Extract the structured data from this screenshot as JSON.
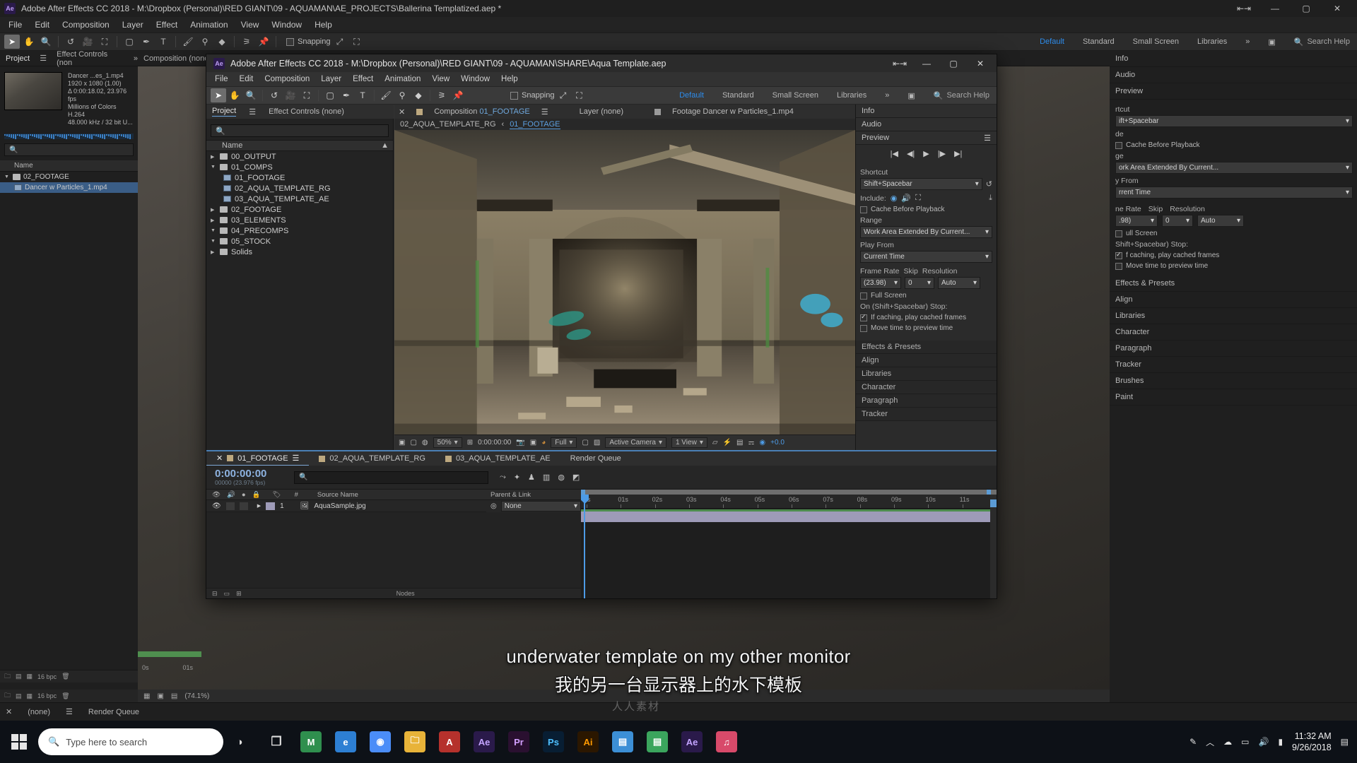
{
  "outer_window": {
    "title": "Adobe After Effects CC 2018 - M:\\Dropbox (Personal)\\RED GIANT\\09 - AQUAMAN\\AE_PROJECTS\\Ballerina Templatized.aep *",
    "app_badge": "Ae",
    "menu": [
      "File",
      "Edit",
      "Composition",
      "Layer",
      "Effect",
      "Animation",
      "View",
      "Window",
      "Help"
    ],
    "snapping_label": "Snapping",
    "workspaces": [
      "Default",
      "Standard",
      "Small Screen",
      "Libraries"
    ],
    "active_workspace": "Default",
    "search_help": "Search Help",
    "panel_tabs": {
      "project": "Project",
      "effect_controls": "Effect Controls (non"
    },
    "viewer_tabs": {
      "composition": "Composition (none)",
      "layer": "Layer (none)",
      "footage": "Footage Dancer w Particles_1.mp4"
    },
    "footage_info": {
      "name": "Dancer ...es_1.mp4",
      "resolution": "1920 x 1080 (1.00)",
      "duration": "Δ 0:00:18.02, 23.976 fps",
      "colors": "Millions of Colors",
      "codec": "H.264",
      "audio": "48.000 kHz / 32 bit U..."
    },
    "column_header": "Name",
    "items": [
      {
        "label": "02_FOOTAGE",
        "type": "folder",
        "expanded": true,
        "selected": false
      },
      {
        "label": "Dancer w Particles_1.mp4",
        "type": "footage",
        "expanded": false,
        "selected": true
      }
    ],
    "bottom_bar": {
      "bpc": "16 bpc",
      "zoom": "(74.1%)"
    },
    "right_panels": [
      "Info",
      "Audio",
      "Preview",
      "Effects & Presets",
      "Align",
      "Libraries",
      "Character",
      "Paragraph",
      "Tracker",
      "Brushes",
      "Paint"
    ],
    "right_preview": {
      "shortcut_label": "rtcut",
      "shortcut_value": "ift+Spacebar",
      "include_label": "de",
      "range_value": "ork Area Extended By Current...",
      "play_from_label": "y From",
      "play_from_value": "rrent Time",
      "frame_rate_label": "ne Rate",
      "skip_label": "Skip",
      "resolution_label": "Resolution",
      "frame_rate_value": ".98)",
      "skip_value": "0",
      "resolution_value": "Auto",
      "full_screen": "ull Screen",
      "stop_label": "Shift+Spacebar) Stop:",
      "cached_frames": "f caching, play cached frames",
      "move_time": "Move time to preview time",
      "cache_before": "Cache Before Playback"
    },
    "timeline_tabs": {
      "none": "(none)",
      "render_queue": "Render Queue"
    },
    "ruler_labels": [
      "0s",
      "01s"
    ]
  },
  "inner_window": {
    "title": "Adobe After Effects CC 2018 - M:\\Dropbox (Personal)\\RED GIANT\\09 - AQUAMAN\\SHARE\\Aqua Template.aep",
    "app_badge": "Ae",
    "menu": [
      "File",
      "Edit",
      "Composition",
      "Layer",
      "Effect",
      "Animation",
      "View",
      "Window",
      "Help"
    ],
    "window_controls": {
      "restore_down": "⇤⇥",
      "minimize": "—",
      "maximize": "▢",
      "close": "✕"
    },
    "snapping_label": "Snapping",
    "workspaces": [
      "Default",
      "Standard",
      "Small Screen",
      "Libraries"
    ],
    "active_workspace": "Default",
    "search_help": "Search Help",
    "overflow": "»",
    "panel_tabs": {
      "project": "Project",
      "effect_controls": "Effect Controls (none)"
    },
    "viewer_tabs": {
      "composition_prefix": "Composition",
      "composition_name": "01_FOOTAGE",
      "layer": "Layer (none)",
      "footage": "Footage Dancer w Particles_1.mp4"
    },
    "breadcrumb": {
      "parent": "02_AQUA_TEMPLATE_RG",
      "separator": "‹",
      "current": "01_FOOTAGE"
    },
    "project_panel": {
      "search_placeholder": "",
      "column_header": "Name",
      "items": [
        {
          "label": "00_OUTPUT",
          "type": "folder",
          "expanded": false,
          "indent": 0
        },
        {
          "label": "01_COMPS",
          "type": "folder",
          "expanded": true,
          "indent": 0
        },
        {
          "label": "01_FOOTAGE",
          "type": "comp",
          "indent": 1
        },
        {
          "label": "02_AQUA_TEMPLATE_RG",
          "type": "comp",
          "indent": 1
        },
        {
          "label": "03_AQUA_TEMPLATE_AE",
          "type": "comp",
          "indent": 1
        },
        {
          "label": "02_FOOTAGE",
          "type": "folder",
          "expanded": false,
          "indent": 0
        },
        {
          "label": "03_ELEMENTS",
          "type": "folder",
          "expanded": false,
          "indent": 0
        },
        {
          "label": "04_PRECOMPS",
          "type": "folder",
          "expanded": true,
          "indent": 0
        },
        {
          "label": "05_STOCK",
          "type": "folder",
          "expanded": true,
          "indent": 0
        },
        {
          "label": "Solids",
          "type": "folder",
          "expanded": false,
          "indent": 0
        }
      ],
      "bottom_bpc": "16 bpc"
    },
    "comp_footer": {
      "zoom": "50%",
      "timecode": "0:00:00:00",
      "resolution": "Full",
      "view": "Active Camera",
      "views": "1 View",
      "exposure": "+0.0"
    },
    "right_panels": {
      "info": "Info",
      "audio": "Audio",
      "preview": "Preview",
      "effects_presets": "Effects & Presets",
      "align": "Align",
      "libraries": "Libraries",
      "character": "Character",
      "paragraph": "Paragraph",
      "tracker": "Tracker"
    },
    "preview_panel": {
      "shortcut_label": "Shortcut",
      "shortcut_value": "Shift+Spacebar",
      "include_label": "Include:",
      "cache_before_playback": "Cache Before Playback",
      "range_label": "Range",
      "range_value": "Work Area Extended By Current...",
      "play_from_label": "Play From",
      "play_from_value": "Current Time",
      "frame_rate_label": "Frame Rate",
      "skip_label": "Skip",
      "resolution_label": "Resolution",
      "frame_rate_value": "(23.98)",
      "skip_value": "0",
      "resolution_value": "Auto",
      "full_screen_label": "Full Screen",
      "stop_label": "On (Shift+Spacebar) Stop:",
      "cached_frames_label": "If caching, play cached frames",
      "move_time_label": "Move time to preview time"
    },
    "timeline": {
      "tabs": [
        {
          "label": "01_FOOTAGE",
          "active": true
        },
        {
          "label": "02_AQUA_TEMPLATE_RG",
          "active": false
        },
        {
          "label": "03_AQUA_TEMPLATE_AE",
          "active": false
        },
        {
          "label": "Render Queue",
          "active": false
        }
      ],
      "timecode": "0:00:00:00",
      "frames": "00000 (23.976 fps)",
      "search_placeholder": "",
      "columns": {
        "source_name": "Source Name",
        "index": "#",
        "parent_link": "Parent & Link"
      },
      "layers": [
        {
          "index": "1",
          "name": "AquaSample.jpg",
          "parent": "None"
        }
      ],
      "ruler_labels": [
        "0s",
        "01s",
        "02s",
        "03s",
        "04s",
        "05s",
        "06s",
        "07s",
        "08s",
        "09s",
        "10s",
        "11s"
      ]
    }
  },
  "subtitles": {
    "english": "underwater template on my other monitor",
    "chinese": "我的另一台显示器上的水下模板",
    "watermark": "人人素材"
  },
  "taskbar": {
    "search_placeholder": "Type here to search",
    "apps": [
      {
        "name": "task-view",
        "glyph": "❐",
        "color": "transparent"
      },
      {
        "name": "app-maya",
        "glyph": "M",
        "color": "#2f8f4e"
      },
      {
        "name": "app-edge",
        "glyph": "e",
        "color": "#2d7fd3"
      },
      {
        "name": "app-chrome",
        "glyph": "◉",
        "color": "#4b8df8"
      },
      {
        "name": "app-explorer",
        "glyph": "🗀",
        "color": "#e8b339"
      },
      {
        "name": "app-acrobat",
        "glyph": "A",
        "color": "#b5312c"
      },
      {
        "name": "app-after-effects",
        "glyph": "Ae",
        "color": "#2a1a4a"
      },
      {
        "name": "app-premiere",
        "glyph": "Pr",
        "color": "#2a1030"
      },
      {
        "name": "app-photoshop",
        "glyph": "Ps",
        "color": "#081e33"
      },
      {
        "name": "app-illustrator",
        "glyph": "Ai",
        "color": "#2b1700"
      },
      {
        "name": "app-finder",
        "glyph": "▤",
        "color": "#3c8fd6"
      },
      {
        "name": "app-notes",
        "glyph": "▤",
        "color": "#3ba55d"
      },
      {
        "name": "app-aftereffects2",
        "glyph": "Ae",
        "color": "#2a1a4a"
      },
      {
        "name": "app-music",
        "glyph": "♫",
        "color": "#d84a6a"
      }
    ],
    "tray": {
      "pen": "✎",
      "chevron": "︿",
      "onedrive": "☁",
      "battery": "▭",
      "volume": "🔊",
      "network": "▮"
    },
    "clock_time": "11:32 AM",
    "clock_date": "9/26/2018"
  },
  "colors": {
    "accent_blue": "#4d9be6",
    "workspace_active": "#2d8ceb",
    "timeline_border": "#4a7fb5",
    "layer_bar": "#9e9bb8"
  }
}
